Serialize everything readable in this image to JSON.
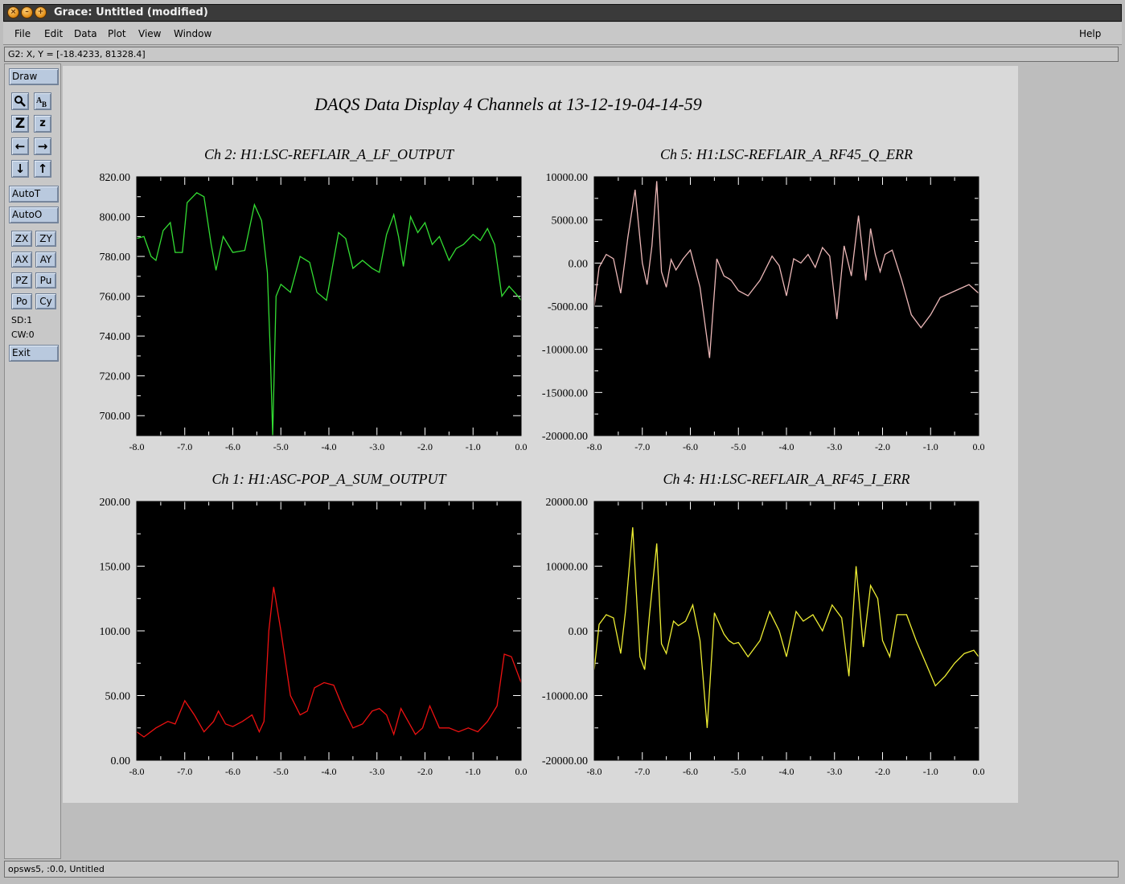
{
  "window": {
    "title": "Grace: Untitled (modified)",
    "title_buttons": [
      "close-icon",
      "minimize-icon",
      "maximize-icon"
    ]
  },
  "menu": {
    "items": [
      "File",
      "Edit",
      "Data",
      "Plot",
      "View",
      "Window"
    ],
    "help": "Help"
  },
  "locator": "G2: X, Y = [-18.4233, 81328.4]",
  "toolbar": {
    "draw": "Draw",
    "auto_t": "AutoT",
    "auto_o": "AutoO",
    "zx": "ZX",
    "zy": "ZY",
    "ax": "AX",
    "ay": "AY",
    "pz": "PZ",
    "pu": "Pu",
    "po": "Po",
    "cy": "Cy",
    "sd": "SD:1",
    "cw": "CW:0",
    "exit": "Exit",
    "icons": [
      "zoom-icon",
      "text-icon",
      "zoom-z-icon",
      "zoom-z-small-icon",
      "left-arrow-icon",
      "right-arrow-icon",
      "down-arrow-icon",
      "up-arrow-icon"
    ]
  },
  "status": "opsws5, :0.0, Untitled",
  "colors": {
    "ch2": "#33dd33",
    "ch5": "#ecb8b8",
    "ch1": "#ee1111",
    "ch4": "#eeee33"
  },
  "chart_data": {
    "title": "DAQS Data Display 4 Channels at 13-12-19-04-14-59",
    "charts": [
      {
        "type": "line",
        "title": "Ch 2:  H1:LSC-REFLAIR_A_LF_OUTPUT",
        "xlim": [
          -8.0,
          0.0
        ],
        "ylim": [
          690,
          820
        ],
        "yticks": [
          "700.00",
          "720.00",
          "740.00",
          "760.00",
          "780.00",
          "800.00",
          "820.00"
        ],
        "xticks": [
          "-8.0",
          "-7.0",
          "-6.0",
          "-5.0",
          "-4.0",
          "-3.0",
          "-2.0",
          "-1.0",
          "0.0"
        ],
        "color": "#33dd33",
        "x": [
          -8.0,
          -7.85,
          -7.7,
          -7.6,
          -7.45,
          -7.3,
          -7.2,
          -7.05,
          -6.95,
          -6.75,
          -6.6,
          -6.45,
          -6.35,
          -6.2,
          -6.0,
          -5.75,
          -5.55,
          -5.4,
          -5.28,
          -5.22,
          -5.17,
          -5.1,
          -5.0,
          -4.8,
          -4.6,
          -4.4,
          -4.25,
          -4.05,
          -3.8,
          -3.65,
          -3.5,
          -3.3,
          -3.1,
          -2.95,
          -2.8,
          -2.65,
          -2.55,
          -2.45,
          -2.3,
          -2.15,
          -2.0,
          -1.85,
          -1.7,
          -1.5,
          -1.35,
          -1.2,
          -1.0,
          -0.85,
          -0.7,
          -0.55,
          -0.4,
          -0.25,
          -0.1,
          0.0
        ],
        "y": [
          789,
          790,
          780,
          778,
          793,
          797,
          782,
          782,
          807,
          812,
          810,
          786,
          773,
          790,
          782,
          783,
          806,
          798,
          772,
          732,
          690,
          760,
          766,
          762,
          780,
          777,
          762,
          758,
          792,
          789,
          774,
          778,
          774,
          772,
          791,
          801,
          790,
          775,
          800,
          792,
          797,
          786,
          790,
          778,
          784,
          786,
          791,
          788,
          794,
          786,
          760,
          765,
          761,
          758
        ]
      },
      {
        "type": "line",
        "title": "Ch 5:  H1:LSC-REFLAIR_A_RF45_Q_ERR",
        "xlim": [
          -8.0,
          0.0
        ],
        "ylim": [
          -20000,
          10000
        ],
        "yticks": [
          "-20000.00",
          "-15000.00",
          "-10000.00",
          "-5000.00",
          "0.00",
          "5000.00",
          "10000.00"
        ],
        "xticks": [
          "-8.0",
          "-7.0",
          "-6.0",
          "-5.0",
          "-4.0",
          "-3.0",
          "-2.0",
          "-1.0",
          "0.0"
        ],
        "color": "#ecb8b8",
        "x": [
          -8.0,
          -7.9,
          -7.75,
          -7.6,
          -7.45,
          -7.3,
          -7.15,
          -7.0,
          -6.9,
          -6.8,
          -6.7,
          -6.6,
          -6.5,
          -6.4,
          -6.3,
          -6.15,
          -6.0,
          -5.8,
          -5.6,
          -5.45,
          -5.3,
          -5.2,
          -5.15,
          -5.0,
          -4.8,
          -4.55,
          -4.3,
          -4.15,
          -4.0,
          -3.85,
          -3.7,
          -3.55,
          -3.4,
          -3.25,
          -3.1,
          -2.95,
          -2.8,
          -2.65,
          -2.5,
          -2.35,
          -2.25,
          -2.15,
          -2.05,
          -1.95,
          -1.8,
          -1.6,
          -1.4,
          -1.2,
          -1.0,
          -0.8,
          -0.6,
          -0.4,
          -0.2,
          0.0
        ],
        "y": [
          -5000,
          -500,
          1000,
          500,
          -3500,
          3000,
          8500,
          0,
          -2500,
          2000,
          9500,
          -1000,
          -2800,
          400,
          -800,
          500,
          1500,
          -2800,
          -11000,
          500,
          -1500,
          -1800,
          -2000,
          -3200,
          -3800,
          -2000,
          800,
          -300,
          -3800,
          500,
          0,
          1000,
          -500,
          1800,
          800,
          -6500,
          2000,
          -1500,
          5500,
          -2000,
          4000,
          1000,
          -1000,
          1000,
          1500,
          -2000,
          -6000,
          -7500,
          -6000,
          -4000,
          -3500,
          -3000,
          -2500,
          -3500
        ]
      },
      {
        "type": "line",
        "title": "Ch 1:  H1:ASC-POP_A_SUM_OUTPUT",
        "xlim": [
          -8.0,
          0.0
        ],
        "ylim": [
          0,
          200
        ],
        "yticks": [
          "0.00",
          "50.00",
          "100.00",
          "150.00",
          "200.00"
        ],
        "xticks": [
          "-8.0",
          "-7.0",
          "-6.0",
          "-5.0",
          "-4.0",
          "-3.0",
          "-2.0",
          "-1.0",
          "0.0"
        ],
        "color": "#ee1111",
        "x": [
          -8.0,
          -7.85,
          -7.6,
          -7.35,
          -7.2,
          -7.0,
          -6.8,
          -6.6,
          -6.4,
          -6.3,
          -6.15,
          -6.0,
          -5.8,
          -5.6,
          -5.45,
          -5.35,
          -5.25,
          -5.15,
          -5.0,
          -4.8,
          -4.6,
          -4.45,
          -4.3,
          -4.1,
          -3.9,
          -3.7,
          -3.5,
          -3.3,
          -3.1,
          -2.95,
          -2.8,
          -2.65,
          -2.5,
          -2.35,
          -2.2,
          -2.05,
          -1.9,
          -1.7,
          -1.5,
          -1.3,
          -1.1,
          -0.9,
          -0.7,
          -0.5,
          -0.35,
          -0.2,
          0.0
        ],
        "y": [
          22,
          18,
          25,
          30,
          28,
          46,
          35,
          22,
          30,
          38,
          28,
          26,
          30,
          35,
          22,
          30,
          100,
          134,
          100,
          50,
          35,
          38,
          56,
          60,
          58,
          40,
          25,
          28,
          38,
          40,
          35,
          20,
          40,
          30,
          20,
          25,
          42,
          25,
          25,
          22,
          25,
          22,
          30,
          42,
          82,
          80,
          60
        ]
      },
      {
        "type": "line",
        "title": "Ch 4:  H1:LSC-REFLAIR_A_RF45_I_ERR",
        "xlim": [
          -8.0,
          0.0
        ],
        "ylim": [
          -20000,
          20000
        ],
        "yticks": [
          "-20000.00",
          "-10000.00",
          "0.00",
          "10000.00",
          "20000.00"
        ],
        "xticks": [
          "-8.0",
          "-7.0",
          "-6.0",
          "-5.0",
          "-4.0",
          "-3.0",
          "-2.0",
          "-1.0",
          "0.0"
        ],
        "color": "#eeee33",
        "x": [
          -8.0,
          -7.9,
          -7.75,
          -7.6,
          -7.45,
          -7.35,
          -7.2,
          -7.05,
          -6.95,
          -6.85,
          -6.7,
          -6.6,
          -6.5,
          -6.35,
          -6.25,
          -6.1,
          -5.95,
          -5.8,
          -5.65,
          -5.5,
          -5.3,
          -5.2,
          -5.1,
          -5.0,
          -4.8,
          -4.55,
          -4.35,
          -4.15,
          -4.0,
          -3.8,
          -3.65,
          -3.45,
          -3.25,
          -3.05,
          -2.85,
          -2.7,
          -2.55,
          -2.4,
          -2.25,
          -2.1,
          -2.0,
          -1.85,
          -1.7,
          -1.5,
          -1.3,
          -1.1,
          -0.9,
          -0.7,
          -0.5,
          -0.3,
          -0.1,
          0.0
        ],
        "y": [
          -6000,
          1000,
          2500,
          2000,
          -3500,
          3000,
          16000,
          -4000,
          -6000,
          2500,
          13500,
          -2000,
          -3500,
          1500,
          800,
          1500,
          4000,
          -1500,
          -15000,
          2800,
          -500,
          -1500,
          -2000,
          -1800,
          -4000,
          -1500,
          3000,
          0,
          -4000,
          3000,
          1500,
          2500,
          0,
          4000,
          2000,
          -7000,
          10000,
          -2500,
          7000,
          5000,
          -1500,
          -4000,
          2500,
          2500,
          -1500,
          -5000,
          -8500,
          -7000,
          -5000,
          -3500,
          -3000,
          -4000
        ]
      }
    ]
  }
}
